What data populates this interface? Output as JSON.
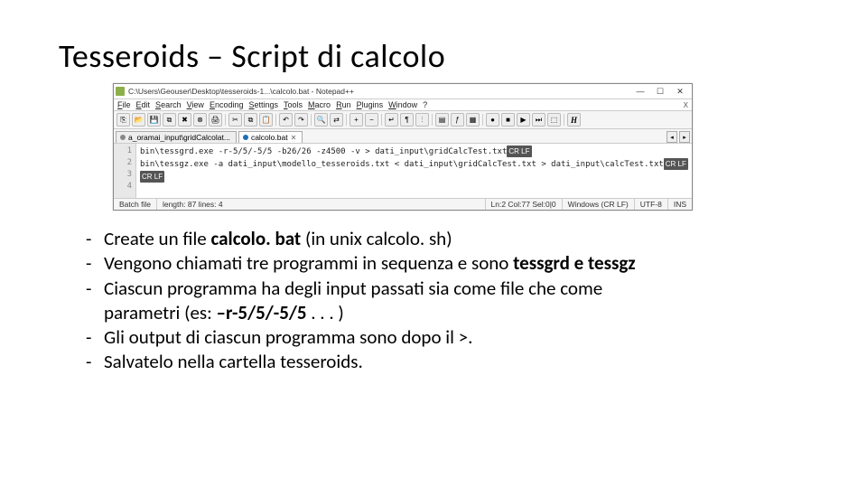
{
  "title": "Tesseroids – Script di calcolo",
  "npp": {
    "titlebar": "C:\\Users\\Geouser\\Desktop\\tesseroids-1...\\calcolo.bat - Notepad++",
    "menus": [
      "File",
      "Edit",
      "Search",
      "View",
      "Encoding",
      "Settings",
      "Tools",
      "Macro",
      "Run",
      "Plugins",
      "Window",
      "?"
    ],
    "menubar_right": "X",
    "toolbar_H": "H",
    "tabs": [
      {
        "label": "a_oramai_input\\gridCalcolat...",
        "active": false
      },
      {
        "label": "calcolo.bat",
        "active": true
      }
    ],
    "lines": [
      "1",
      "2",
      "3",
      "4"
    ],
    "code": {
      "l1a": "bin\\tessgrd.exe -r-5/5/-5/5 -b26/26 -z4500 -v > dati_input\\gridCalcTest.txt",
      "l1b": "CR LF",
      "l2a": "bin\\tessgz.exe -a dati_input\\modello_tesseroids.txt < dati_input\\gridCalcTest.txt > dati_input\\calcTest.txt",
      "l2b": "CR LF",
      "l3": "CR LF"
    },
    "status": {
      "type": "Batch file",
      "length": "length: 87   lines: 4",
      "pos": "Ln:2  Col:77  Sel:0|0",
      "eol": "Windows (CR LF)",
      "enc": "UTF-8",
      "mode": "INS"
    }
  },
  "bullets": [
    {
      "pre": "Create un file ",
      "bold": "calcolo. bat ",
      "post": "(in unix calcolo. sh)"
    },
    {
      "pre": "Vengono chiamati tre programmi in sequenza e sono ",
      "bold": "tessgrd e tessgz",
      "post": ""
    },
    {
      "pre": "Ciascun programma ha degli input passati sia come file che come",
      "bold": "",
      "post": ""
    },
    {
      "cont": true,
      "pre": "parametri (es: ",
      "bold": "–r-5/5/-5/5 ",
      "post": ". . . )"
    },
    {
      "pre": "Gli output di ciascun programma sono dopo il >.",
      "bold": "",
      "post": ""
    },
    {
      "pre": "Salvatelo nella cartella tesseroids.",
      "bold": "",
      "post": ""
    }
  ]
}
